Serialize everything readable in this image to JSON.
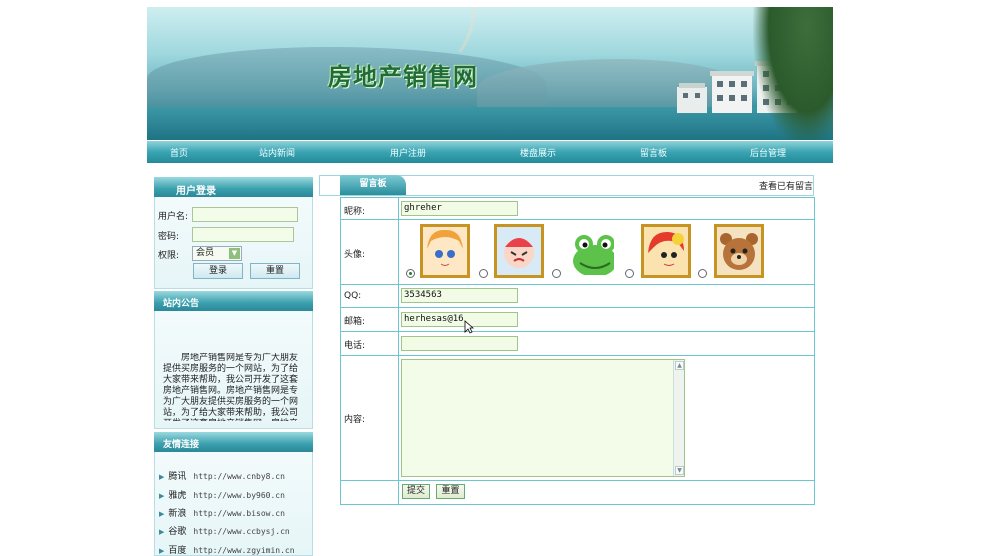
{
  "header": {
    "site_title": "房地产销售网"
  },
  "nav": {
    "items": [
      "首页",
      "站内新闻",
      "用户注册",
      "楼盘展示",
      "留言板",
      "后台管理"
    ]
  },
  "login": {
    "title": "用户登录",
    "username_label": "用户名:",
    "username_value": "",
    "password_label": "密码:",
    "password_value": "",
    "role_label": "权限:",
    "role_selected": "会员",
    "login_button": "登录",
    "reset_button": "重置"
  },
  "notice": {
    "title": "站内公告",
    "text": "房地产销售网是专为广大朋友提供买房服务的一个网站，为了给大家带来帮助，我公司开发了这套房地产销售网。房地产销售网是专为广大朋友提供买房服务的一个网站，为了给大家带来帮助，我公司开发了这套房地产销售网。房地产销售网"
  },
  "links": {
    "title": "友情连接",
    "items": [
      {
        "name": "腾讯",
        "url": "http://www.cnby8.cn"
      },
      {
        "name": "雅虎",
        "url": "http://www.by960.cn"
      },
      {
        "name": "新浪",
        "url": "http://www.bisow.cn"
      },
      {
        "name": "谷歌",
        "url": "http://www.ccbysj.cn"
      },
      {
        "name": "百度",
        "url": "http://www.zgyimin.cn"
      }
    ]
  },
  "guestbook": {
    "tab": "留言板",
    "view_all": "查看已有留言",
    "nickname_label": "昵称:",
    "nickname_value": "ghreher",
    "avatar_label": "头像:",
    "avatar_selected_index": 0,
    "avatar_icons": [
      "girl-avatar-icon",
      "crying-baby-avatar-icon",
      "frog-avatar-icon",
      "red-hair-avatar-icon",
      "bear-avatar-icon"
    ],
    "qq_label": "QQ:",
    "qq_value": "3534563",
    "email_label": "邮箱:",
    "email_value": "herhesas@16",
    "phone_label": "电话:",
    "phone_value": "",
    "content_label": "内容:",
    "content_value": "",
    "submit_button": "提交",
    "reset_button": "重置"
  }
}
